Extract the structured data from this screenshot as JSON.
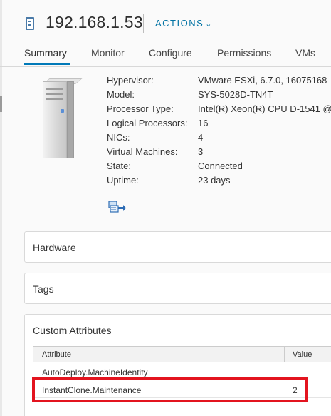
{
  "header": {
    "host_icon": "host-icon",
    "title": "192.168.1.53",
    "actions_label": "ACTIONS",
    "actions_chevron": "⌄"
  },
  "tabs": [
    {
      "label": "Summary",
      "active": true
    },
    {
      "label": "Monitor"
    },
    {
      "label": "Configure"
    },
    {
      "label": "Permissions"
    },
    {
      "label": "VMs"
    }
  ],
  "summary": {
    "image": "server-tower-icon",
    "properties": [
      {
        "key": "Hypervisor:",
        "value": "VMware ESXi, 6.7.0, 16075168"
      },
      {
        "key": "Model:",
        "value": "SYS-5028D-TN4T"
      },
      {
        "key": "Processor Type:",
        "value": "Intel(R) Xeon(R) CPU D-1541 @"
      },
      {
        "key": "Logical Processors:",
        "value": "16"
      },
      {
        "key": "NICs:",
        "value": "4"
      },
      {
        "key": "Virtual Machines:",
        "value": "3"
      },
      {
        "key": "State:",
        "value": "Connected"
      },
      {
        "key": "Uptime:",
        "value": "23 days"
      }
    ],
    "action_icon": "migrate-vm-icon"
  },
  "cards": {
    "hardware": {
      "title": "Hardware"
    },
    "tags": {
      "title": "Tags"
    },
    "custom_attributes": {
      "title": "Custom Attributes",
      "columns": [
        "Attribute",
        "Value"
      ],
      "rows": [
        {
          "attribute": "AutoDeploy.MachineIdentity",
          "value": ""
        },
        {
          "attribute": "InstantClone.Maintenance",
          "value": "2"
        }
      ]
    }
  },
  "colors": {
    "accent": "#0079b8",
    "link": "#0072a3",
    "highlight": "#e3141f"
  }
}
